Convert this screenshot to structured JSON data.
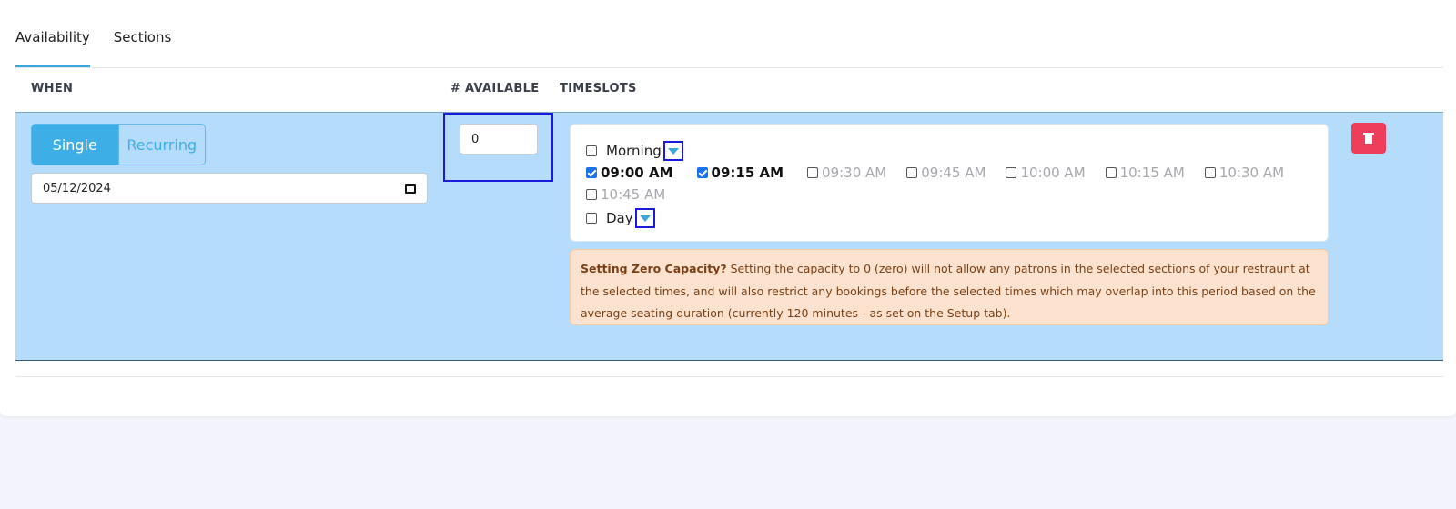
{
  "tabs": [
    {
      "label": "Availability",
      "active": true
    },
    {
      "label": "Sections",
      "active": false
    }
  ],
  "table": {
    "headers": {
      "when": "WHEN",
      "available": "# AVAILABLE",
      "timeslots": "TIMESLOTS"
    }
  },
  "row": {
    "mode": {
      "single": "Single",
      "recurring": "Recurring",
      "selected": "Single"
    },
    "date": "05/12/2024",
    "available": "0",
    "groups": [
      {
        "label": "Morning",
        "checked": false,
        "icon": "caret-down-icon"
      },
      {
        "label": "Day",
        "checked": false,
        "icon": "caret-down-icon"
      }
    ],
    "slots": [
      {
        "label": "09:00 AM",
        "checked": true
      },
      {
        "label": "09:15 AM",
        "checked": true
      },
      {
        "label": "09:30 AM",
        "checked": false
      },
      {
        "label": "09:45 AM",
        "checked": false
      },
      {
        "label": "10:00 AM",
        "checked": false
      },
      {
        "label": "10:15 AM",
        "checked": false
      },
      {
        "label": "10:30 AM",
        "checked": false
      },
      {
        "label": "10:45 AM",
        "checked": false
      }
    ],
    "warning": {
      "title": "Setting Zero Capacity?",
      "text": "Setting the capacity to 0 (zero) will not allow any patrons in the selected sections of your restraunt at the selected times, and will also restrict any bookings before the selected times which may overlap into this period based on the average seating duration (currently 120 minutes - as set on the Setup tab)."
    },
    "delete_icon": "trash-icon"
  },
  "colors": {
    "accent": "#3eaee6",
    "row_bg": "#b6dcfb",
    "warning_bg": "#fde3cf",
    "warning_text": "#7a3f14",
    "danger": "#ef3d5c",
    "page_bg": "#f3f4fb"
  }
}
